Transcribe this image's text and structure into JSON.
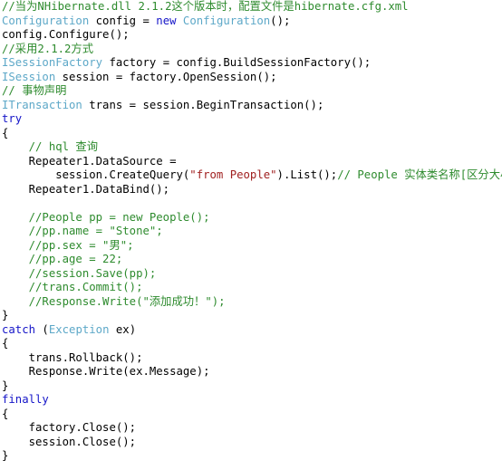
{
  "editor": {
    "language": "csharp",
    "background": "#ffffff",
    "colors": {
      "plain": "#000000",
      "comment": "#2e8b2e",
      "keyword": "#1515c8",
      "type": "#5da8c8",
      "string": "#a02020"
    }
  },
  "code": {
    "lines": [
      {
        "tokens": [
          {
            "t": "//当为NHibernate.dll 2.1.2这个版本时，配置文件是hibernate.cfg.xml",
            "c": "comment"
          }
        ]
      },
      {
        "tokens": [
          {
            "t": "Configuration",
            "c": "type"
          },
          {
            "t": " config = ",
            "c": "plain"
          },
          {
            "t": "new",
            "c": "keyword"
          },
          {
            "t": " ",
            "c": "plain"
          },
          {
            "t": "Configuration",
            "c": "type"
          },
          {
            "t": "();",
            "c": "plain"
          }
        ]
      },
      {
        "tokens": [
          {
            "t": "config.Configure();",
            "c": "plain"
          }
        ]
      },
      {
        "tokens": [
          {
            "t": "//采用2.1.2方式",
            "c": "comment"
          }
        ]
      },
      {
        "tokens": [
          {
            "t": "ISessionFactory",
            "c": "type"
          },
          {
            "t": " factory = config.BuildSessionFactory();",
            "c": "plain"
          }
        ]
      },
      {
        "tokens": [
          {
            "t": "ISession",
            "c": "type"
          },
          {
            "t": " session = factory.OpenSession();",
            "c": "plain"
          }
        ]
      },
      {
        "tokens": [
          {
            "t": "// 事物声明",
            "c": "comment"
          }
        ]
      },
      {
        "tokens": [
          {
            "t": "ITransaction",
            "c": "type"
          },
          {
            "t": " trans = session.BeginTransaction();",
            "c": "plain"
          }
        ]
      },
      {
        "tokens": [
          {
            "t": "try",
            "c": "keyword"
          }
        ]
      },
      {
        "tokens": [
          {
            "t": "{",
            "c": "plain"
          }
        ]
      },
      {
        "tokens": [
          {
            "t": "    // hql 查询",
            "c": "comment"
          }
        ]
      },
      {
        "tokens": [
          {
            "t": "    Repeater1.DataSource =",
            "c": "plain"
          }
        ]
      },
      {
        "tokens": [
          {
            "t": "        session.CreateQuery(",
            "c": "plain"
          },
          {
            "t": "\"from People\"",
            "c": "string"
          },
          {
            "t": ").List();",
            "c": "plain"
          },
          {
            "t": "// People 实体类名称[区分大小写]",
            "c": "comment"
          }
        ]
      },
      {
        "tokens": [
          {
            "t": "    Repeater1.DataBind();",
            "c": "plain"
          }
        ]
      },
      {
        "tokens": [
          {
            "t": "",
            "c": "plain"
          }
        ]
      },
      {
        "tokens": [
          {
            "t": "    //People pp = new People();",
            "c": "comment"
          }
        ]
      },
      {
        "tokens": [
          {
            "t": "    //pp.name = \"Stone\";",
            "c": "comment"
          }
        ]
      },
      {
        "tokens": [
          {
            "t": "    //pp.sex = \"男\";",
            "c": "comment"
          }
        ]
      },
      {
        "tokens": [
          {
            "t": "    //pp.age = 22;",
            "c": "comment"
          }
        ]
      },
      {
        "tokens": [
          {
            "t": "    //session.Save(pp);",
            "c": "comment"
          }
        ]
      },
      {
        "tokens": [
          {
            "t": "    //trans.Commit();",
            "c": "comment"
          }
        ]
      },
      {
        "tokens": [
          {
            "t": "    //Response.Write(\"添加成功！\");",
            "c": "comment"
          }
        ]
      },
      {
        "tokens": [
          {
            "t": "}",
            "c": "plain"
          }
        ]
      },
      {
        "tokens": [
          {
            "t": "catch",
            "c": "keyword"
          },
          {
            "t": " (",
            "c": "plain"
          },
          {
            "t": "Exception",
            "c": "type"
          },
          {
            "t": " ex)",
            "c": "plain"
          }
        ]
      },
      {
        "tokens": [
          {
            "t": "{",
            "c": "plain"
          }
        ]
      },
      {
        "tokens": [
          {
            "t": "    trans.Rollback();",
            "c": "plain"
          }
        ]
      },
      {
        "tokens": [
          {
            "t": "    Response.Write(ex.Message);",
            "c": "plain"
          }
        ]
      },
      {
        "tokens": [
          {
            "t": "}",
            "c": "plain"
          }
        ]
      },
      {
        "tokens": [
          {
            "t": "finally",
            "c": "keyword"
          }
        ]
      },
      {
        "tokens": [
          {
            "t": "{",
            "c": "plain"
          }
        ]
      },
      {
        "tokens": [
          {
            "t": "    factory.Close();",
            "c": "plain"
          }
        ]
      },
      {
        "tokens": [
          {
            "t": "    session.Close();",
            "c": "plain"
          }
        ]
      },
      {
        "tokens": [
          {
            "t": "}",
            "c": "plain"
          }
        ]
      }
    ]
  }
}
